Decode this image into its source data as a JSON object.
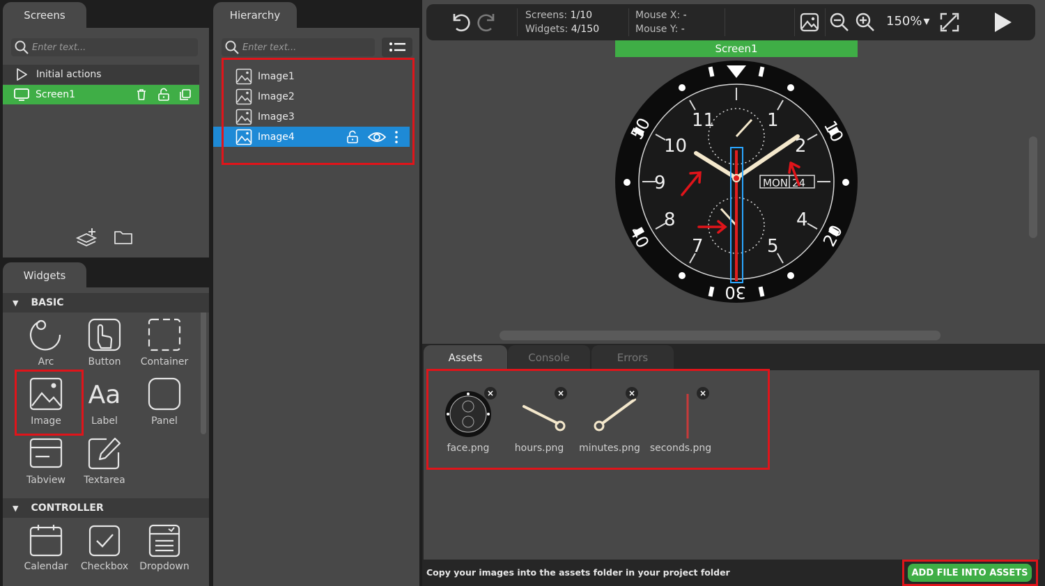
{
  "screens_panel": {
    "tab_label": "Screens",
    "search_placeholder": "Enter text...",
    "items": [
      {
        "label": "Initial actions"
      },
      {
        "label": "Screen1"
      }
    ]
  },
  "hierarchy_panel": {
    "tab_label": "Hierarchy",
    "search_placeholder": "Enter text...",
    "items": [
      {
        "label": "Image1"
      },
      {
        "label": "Image2"
      },
      {
        "label": "Image3"
      },
      {
        "label": "Image4"
      }
    ]
  },
  "widgets_panel": {
    "tab_label": "Widgets",
    "sections": [
      {
        "title": "BASIC",
        "items": [
          "Arc",
          "Button",
          "Container",
          "Image",
          "Label",
          "Panel",
          "Tabview",
          "Textarea"
        ]
      },
      {
        "title": "CONTROLLER",
        "items": [
          "Calendar",
          "Checkbox",
          "Dropdown"
        ]
      }
    ]
  },
  "toolbar": {
    "screens_label": "Screens:",
    "screens_value": "1/10",
    "widgets_label": "Widgets:",
    "widgets_value": "4/150",
    "mouse_x_label": "Mouse X:",
    "mouse_x_value": "-",
    "mouse_y_label": "Mouse Y:",
    "mouse_y_value": "-",
    "zoom": "150%",
    "zoom_caret": "▾"
  },
  "canvas": {
    "screen_label": "Screen1",
    "watch": {
      "hour_numbers": [
        "11",
        "1",
        "10",
        "2",
        "9",
        "8",
        "4",
        "7",
        "5"
      ],
      "bezel_numbers": [
        "50",
        "10",
        "40",
        "20",
        "30"
      ],
      "date_day": "MON",
      "date_num": "24"
    }
  },
  "bottom_panel": {
    "tabs": [
      "Assets",
      "Console",
      "Errors"
    ],
    "assets": [
      {
        "file": "face.png"
      },
      {
        "file": "hours.png"
      },
      {
        "file": "minutes.png"
      },
      {
        "file": "seconds.png"
      }
    ],
    "remove_glyph": "×",
    "hint": "Copy your images into the assets folder in your project folder",
    "add_button": "ADD FILE INTO ASSETS"
  },
  "colors": {
    "accent_green": "#3fae46",
    "selection_blue": "#1e8ad6",
    "highlight_red": "#e0141a"
  }
}
